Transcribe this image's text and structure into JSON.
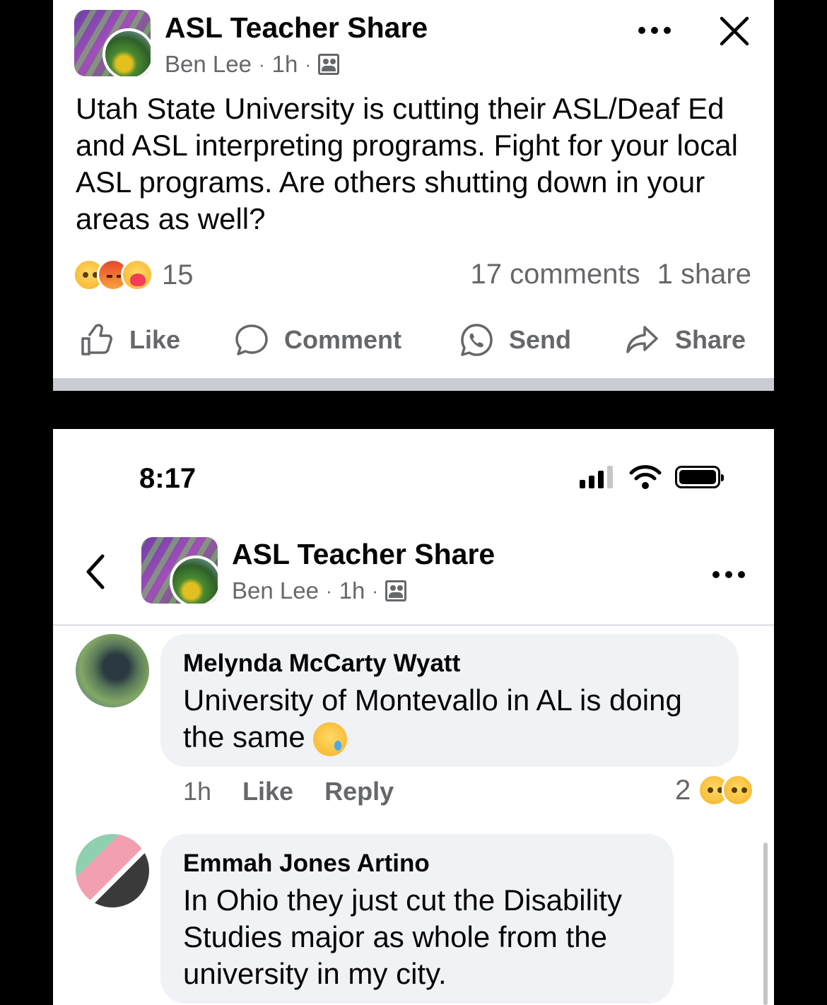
{
  "post": {
    "group_name": "ASL Teacher Share",
    "author": "Ben Lee",
    "time": "1h",
    "body": "Utah State University is cutting their ASL/Deaf Ed and ASL interpreting programs.  Fight for your local ASL programs.  Are others shutting down in your areas as well?",
    "reactions": [
      "sad-reaction-icon",
      "angry-reaction-icon",
      "care-reaction-icon"
    ],
    "reaction_count": "15",
    "comments_count": "17 comments",
    "shares_count": "1 share",
    "actions": {
      "like": "Like",
      "comment": "Comment",
      "send": "Send",
      "share": "Share"
    }
  },
  "status_bar": {
    "time": "8:17"
  },
  "header": {
    "group_name": "ASL Teacher Share",
    "author": "Ben Lee",
    "time": "1h"
  },
  "comments": [
    {
      "name": "Melynda McCarty Wyatt",
      "text": "University of Montevallo in AL is doing the same",
      "emoji": "crying-face-emoji",
      "time": "1h",
      "like": "Like",
      "reply": "Reply",
      "reaction_count": "2",
      "reactions": [
        "wow-reaction-icon",
        "sad-reaction-icon"
      ]
    },
    {
      "name": "Emmah Jones Artino",
      "text": "In Ohio they just cut the Disability Studies major as whole from the university in my city."
    }
  ],
  "colors": {
    "text": "#050505",
    "secondary": "#65676b",
    "bubble": "#f0f2f5",
    "background": "#000000"
  }
}
